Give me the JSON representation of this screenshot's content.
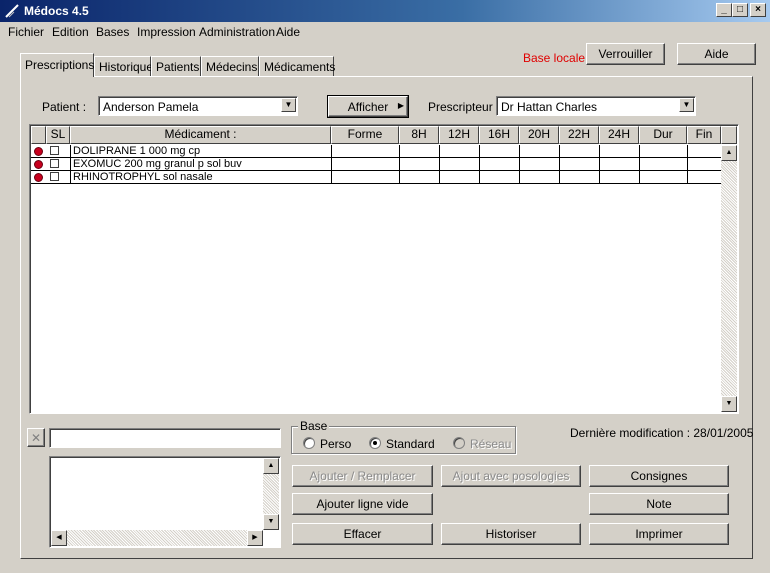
{
  "window": {
    "title": "Médocs 4.5"
  },
  "menu": [
    "Fichier",
    "Edition",
    "Bases",
    "Impression",
    "Administration",
    "Aide"
  ],
  "header": {
    "status": "Base locale",
    "lock_label": "Verrouiller",
    "help_label": "Aide"
  },
  "tabs": [
    "Prescriptions",
    "Historique",
    "Patients",
    "Médecins",
    "Médicaments"
  ],
  "patient": {
    "label": "Patient :",
    "value": "Anderson Pamela"
  },
  "show_label": "Afficher",
  "prescriber": {
    "label": "Prescripteur :",
    "value": "Dr Hattan Charles"
  },
  "grid": {
    "columns": [
      "SL",
      "Médicament :",
      "Forme",
      "8H",
      "12H",
      "16H",
      "20H",
      "22H",
      "24H",
      "Dur",
      "Fin"
    ],
    "rows": [
      {
        "medicament": "DOLIPRANE 1 000 mg cp"
      },
      {
        "medicament": "EXOMUC 200 mg granul p sol buv"
      },
      {
        "medicament": "RHINOTROPHYL sol nasale"
      }
    ]
  },
  "base_group": {
    "title": "Base",
    "options": [
      "Perso",
      "Standard",
      "Réseau"
    ],
    "selected": "Standard"
  },
  "last_modified": "Dernière modification : 28/01/2005",
  "buttons": {
    "add_replace": "Ajouter / Remplacer",
    "add_dosage": "Ajout avec posologies",
    "instructions": "Consignes",
    "add_empty": "Ajouter ligne vide",
    "note": "Note",
    "clear": "Effacer",
    "archive": "Historiser",
    "print": "Imprimer"
  },
  "colors": {
    "titlebar": "#0a246a",
    "status_red": "#e00000",
    "dot_red": "#c8001e",
    "face": "#d4d0c8"
  }
}
